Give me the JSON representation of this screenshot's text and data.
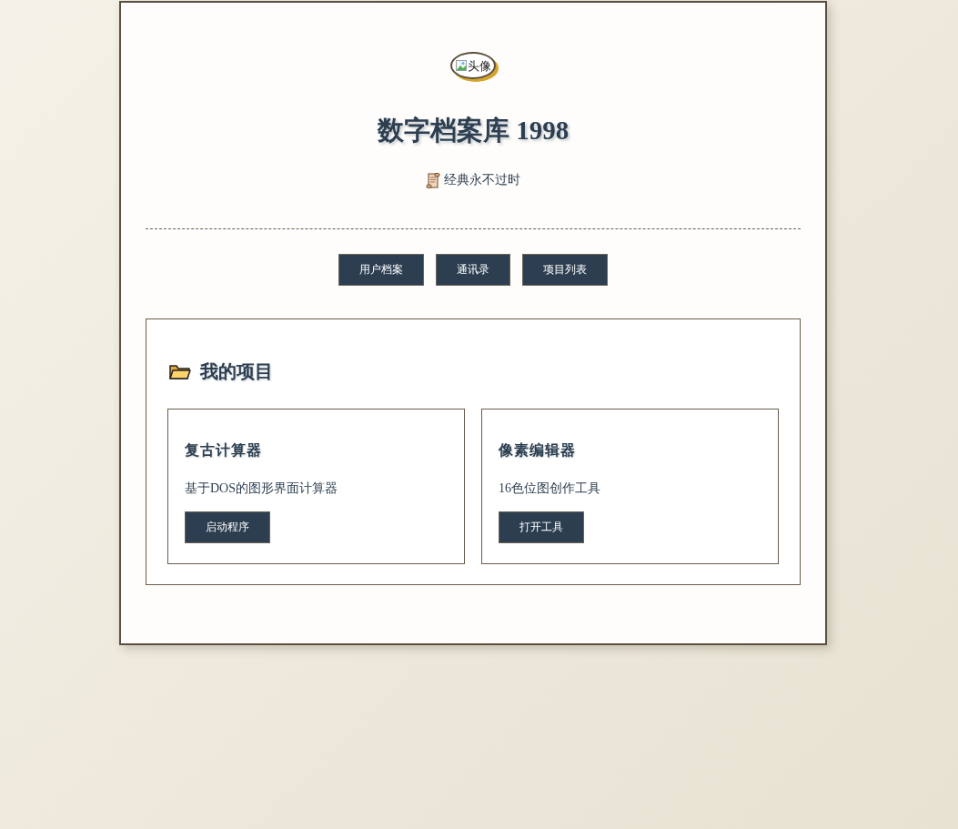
{
  "avatar": {
    "alt_text": "头像"
  },
  "header": {
    "title": "数字档案库 1998",
    "tagline": "经典永不过时"
  },
  "nav": [
    {
      "label": "用户档案"
    },
    {
      "label": "通讯录"
    },
    {
      "label": "项目列表"
    }
  ],
  "projects": {
    "heading": "我的项目",
    "items": [
      {
        "title": "复古计算器",
        "description": "基于DOS的图形界面计算器",
        "button": "启动程序"
      },
      {
        "title": "像素编辑器",
        "description": "16色位图创作工具",
        "button": "打开工具"
      }
    ]
  }
}
